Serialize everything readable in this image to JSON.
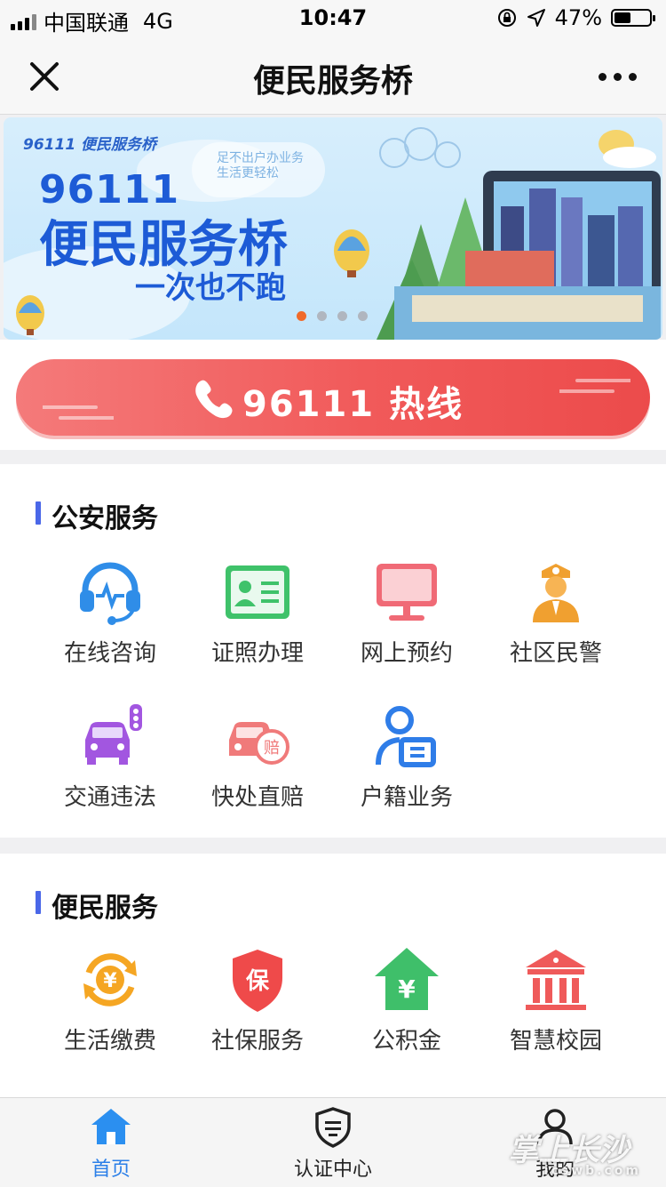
{
  "status_bar": {
    "carrier": "中国联通",
    "network": "4G",
    "time": "10:47",
    "battery": "47%",
    "battery_level": 0.47
  },
  "nav": {
    "title": "便民服务桥",
    "close_icon": "close-icon",
    "more_icon": "more-icon"
  },
  "banner": {
    "brand": "96111 便民服务桥",
    "number": "96111",
    "title": "便民服务桥",
    "subtitle": "一次也不跑",
    "cloud_text_1": "足不出户办业务",
    "cloud_text_2": "生活更轻松",
    "active_dot": 0,
    "dot_count": 4
  },
  "hotline": {
    "label": "96111 热线",
    "icon": "phone-icon",
    "color": "#f15a5a"
  },
  "police_section": {
    "title": "公安服务",
    "items": [
      {
        "label": "在线咨询",
        "icon": "headset-icon"
      },
      {
        "label": "证照办理",
        "icon": "id-card-icon"
      },
      {
        "label": "网上预约",
        "icon": "monitor-icon"
      },
      {
        "label": "社区民警",
        "icon": "police-officer-icon"
      },
      {
        "label": "交通违法",
        "icon": "car-traffic-light-icon"
      },
      {
        "label": "快处直赔",
        "icon": "car-compensation-icon"
      },
      {
        "label": "户籍业务",
        "icon": "person-document-icon"
      }
    ]
  },
  "civil_section": {
    "title": "便民服务",
    "items": [
      {
        "label": "生活缴费",
        "icon": "yuan-cycle-icon"
      },
      {
        "label": "社保服务",
        "icon": "shield-bao-icon"
      },
      {
        "label": "公积金",
        "icon": "house-yuan-icon"
      },
      {
        "label": "智慧校园",
        "icon": "school-building-icon"
      }
    ]
  },
  "tabbar": {
    "items": [
      {
        "label": "首页",
        "icon": "home-icon",
        "active": true
      },
      {
        "label": "认证中心",
        "icon": "shield-check-icon",
        "active": false
      },
      {
        "label": "我的",
        "icon": "user-icon",
        "active": false
      }
    ]
  },
  "watermark": {
    "text": "掌上长沙",
    "sub": "icswb.com"
  },
  "colors": {
    "accent": "#4a67e8",
    "tab_active": "#2b7fe8",
    "dot_active": "#f06a2a"
  }
}
